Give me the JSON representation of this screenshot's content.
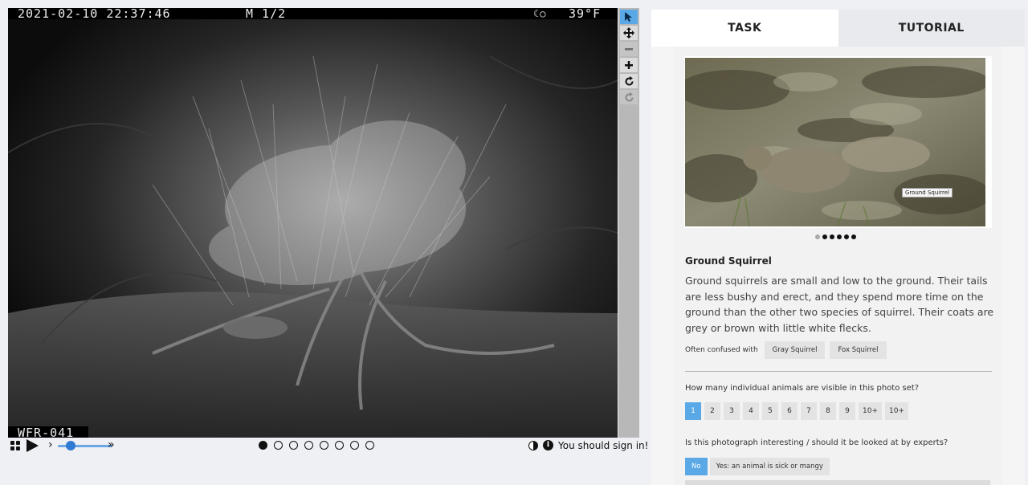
{
  "camera": {
    "timestamp": "2021-02-10 22:37:46",
    "mode": "M 1/2",
    "moon_glyph": "☾○",
    "temperature": "39°F",
    "site_id": "WFR-041"
  },
  "toolbar": {
    "items": [
      {
        "icon": "pointer-icon",
        "state": "active"
      },
      {
        "icon": "move-icon",
        "state": "normal"
      },
      {
        "icon": "zoom-out-icon",
        "state": "disabled"
      },
      {
        "icon": "zoom-in-icon",
        "state": "normal"
      },
      {
        "icon": "rotate-icon",
        "state": "normal"
      },
      {
        "icon": "reset-icon",
        "state": "disabled"
      }
    ]
  },
  "controls": {
    "chev_left": "›",
    "chev_right": "»",
    "frame_count": 8,
    "current_frame": 1,
    "sign_in_text": "You should sign in!"
  },
  "tabs": {
    "task": "TASK",
    "tutorial": "TUTORIAL",
    "active": "task"
  },
  "example": {
    "image_label": "Ground Squirrel",
    "carousel_count": 6,
    "carousel_current": 1
  },
  "animal": {
    "name": "Ground Squirrel",
    "description": "Ground squirrels are small and low to the ground. Their tails are less bushy and erect, and they spend more time on the ground than the other two species of squirrel. Their coats are grey or brown with little white flecks.",
    "confused_label": "Often confused with",
    "confused_with": [
      "Gray Squirrel",
      "Fox Squirrel"
    ]
  },
  "question_count": {
    "text": "How many individual animals are visible in this photo set?",
    "options": [
      "1",
      "2",
      "3",
      "4",
      "5",
      "6",
      "7",
      "8",
      "9",
      "10+",
      "10+"
    ],
    "selected": "1"
  },
  "question_interesting": {
    "text": "Is this photograph interesting / should it be looked at by experts?",
    "options": [
      "No",
      "Yes: an animal is sick or mangy"
    ],
    "selected": "No"
  },
  "colors": {
    "accent": "#5aa9e6",
    "slider": "#2f7bd3"
  }
}
